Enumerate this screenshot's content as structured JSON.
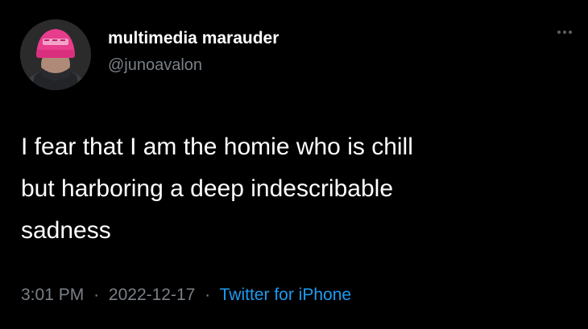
{
  "tweet": {
    "author": {
      "display_name": "multimedia marauder",
      "handle": "@junoavalon",
      "avatar_icon": "user-avatar-pink-beanie"
    },
    "text_lines": [
      "I fear that I am the homie who is chill",
      "but harboring a deep indescribable",
      "sadness"
    ],
    "meta": {
      "time": "3:01 PM",
      "separator": "·",
      "date": "2022-12-17",
      "source": "Twitter for iPhone"
    },
    "menu_icon": "more-options-icon"
  },
  "colors": {
    "background": "#000000",
    "text": "#ffffff",
    "secondary_text": "#7a8087",
    "link": "#1d9bf0"
  }
}
